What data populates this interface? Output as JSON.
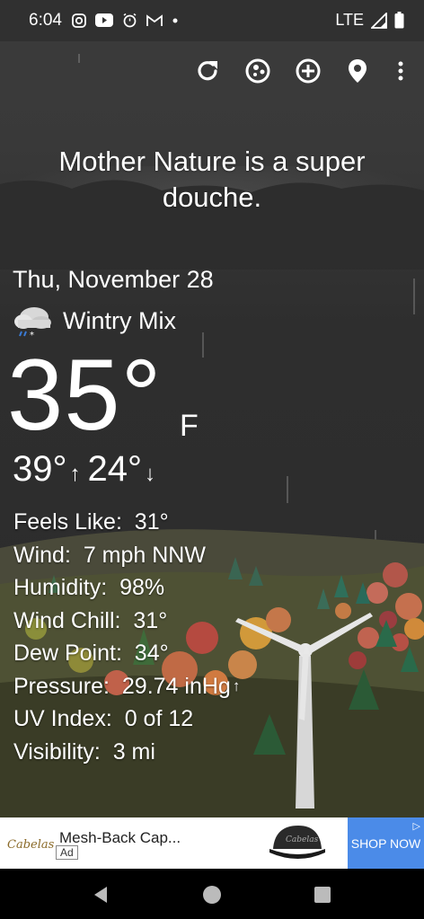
{
  "status_bar": {
    "time": "6:04",
    "network": "LTE",
    "icons": [
      "instagram-icon",
      "youtube-icon",
      "alarm-icon",
      "gmail-icon",
      "dot-icon"
    ]
  },
  "toolbar": {
    "icons": [
      "refresh-icon",
      "theme-icon",
      "add-location-icon",
      "location-icon",
      "more-icon"
    ]
  },
  "quote": "Mother Nature is a super douche.",
  "weather": {
    "date": "Thu, November 28",
    "condition": "Wintry Mix",
    "condition_icon": "wintry-mix-icon",
    "temperature": "35°",
    "unit": "F",
    "high": "39°",
    "low": "24°",
    "details": [
      {
        "label": "Feels Like:",
        "value": "31°"
      },
      {
        "label": "Wind:",
        "value": "7 mph NNW"
      },
      {
        "label": "Humidity:",
        "value": "98%"
      },
      {
        "label": "Wind Chill:",
        "value": "31°"
      },
      {
        "label": "Dew Point:",
        "value": "34°"
      },
      {
        "label": "Pressure:",
        "value": "29.74 inHg"
      },
      {
        "label": "UV Index:",
        "value": "0 of 12"
      },
      {
        "label": "Visibility:",
        "value": "3 mi"
      }
    ]
  },
  "ad": {
    "brand": "Cabelas",
    "title": "Mesh-Back Cap...",
    "badge": "Ad",
    "cta": "SHOP NOW"
  },
  "colors": {
    "ad_cta": "#4b8be8",
    "background": "#2a2a2a"
  }
}
